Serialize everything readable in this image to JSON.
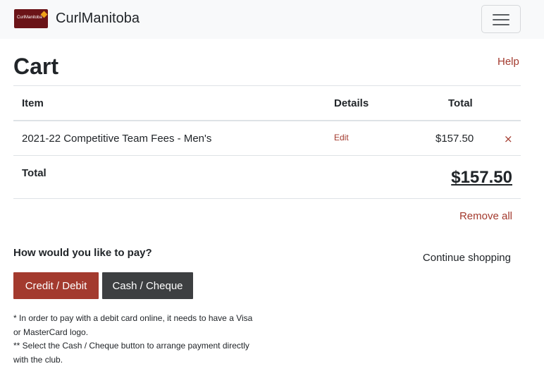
{
  "navbar": {
    "logo_text": "CurlManitoba",
    "brand_name": "CurlManitoba",
    "toggler_icon": "hamburger-menu-icon"
  },
  "page": {
    "title": "Cart",
    "help_label": "Help"
  },
  "cart": {
    "headers": {
      "item": "Item",
      "details": "Details",
      "total": "Total"
    },
    "rows": [
      {
        "item": "2021-22 Competitive Team Fees - Men's",
        "details_link": "Edit",
        "total": "$157.50",
        "remove_symbol": "×"
      }
    ],
    "total_label": "Total",
    "total_amount": "$157.50",
    "remove_all_label": "Remove all"
  },
  "payment": {
    "question": "How would you like to pay?",
    "continue_label": "Continue shopping",
    "credit_label": "Credit / Debit",
    "cash_label": "Cash / Cheque",
    "note_1": "* In order to pay with a debit card online, it needs to have a Visa or MasterCard logo.",
    "note_2": "** Select the Cash / Cheque button to arrange payment directly with the club."
  },
  "colors": {
    "accent": "#a33a2e",
    "dark_button": "#3d3f41",
    "navbar_bg": "#f8f9fa",
    "logo_bg": "#6b1418"
  }
}
